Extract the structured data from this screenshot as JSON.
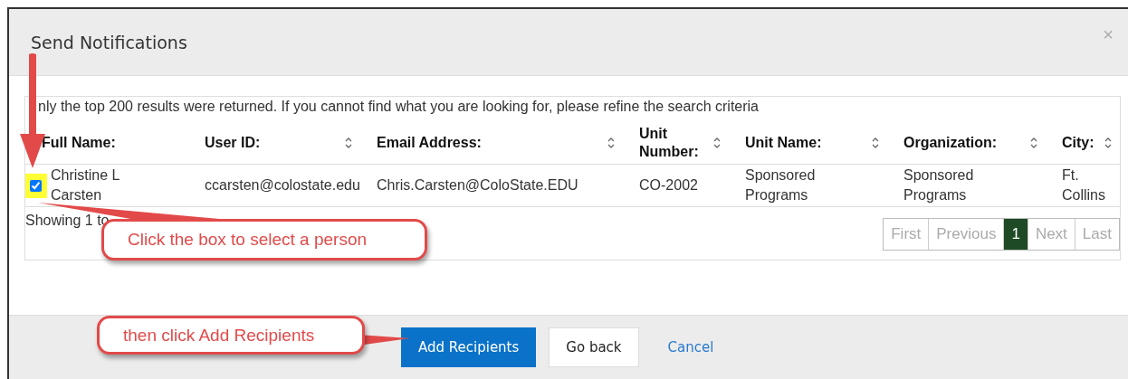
{
  "dialog": {
    "title": "Send Notifications",
    "close": "×"
  },
  "notice": "nly the top 200 results were returned. If you cannot find what you are looking for, please refine the search criteria",
  "table": {
    "columns": [
      {
        "label": "Full Name:",
        "sortable": false
      },
      {
        "label": "User ID:",
        "sortable": true
      },
      {
        "label": "Email Address:",
        "sortable": true
      },
      {
        "label": "Unit Number:",
        "sortable": true
      },
      {
        "label": "Unit Name:",
        "sortable": true
      },
      {
        "label": "Organization:",
        "sortable": true
      },
      {
        "label": "City:",
        "sortable": true
      }
    ],
    "rows": [
      {
        "selected": true,
        "cells": [
          "Christine L Carsten",
          "ccarsten@colostate.edu",
          "Chris.Carsten@ColoState.EDU",
          "CO-2002",
          "Sponsored Programs",
          "Sponsored Programs",
          "Ft. Collins"
        ]
      }
    ]
  },
  "showing": "Showing 1 to",
  "pagination": [
    {
      "label": "First",
      "selected": false
    },
    {
      "label": "Previous",
      "selected": false
    },
    {
      "label": "1",
      "selected": true
    },
    {
      "label": "Next",
      "selected": false
    },
    {
      "label": "Last",
      "selected": false
    }
  ],
  "footer_buttons": [
    {
      "label": "Add Recipients",
      "kind": "primary"
    },
    {
      "label": "Go back",
      "kind": "default"
    },
    {
      "label": "Cancel",
      "kind": "link"
    }
  ],
  "annotations": [
    "Click the box to select a person",
    "then click Add Recipients"
  ]
}
